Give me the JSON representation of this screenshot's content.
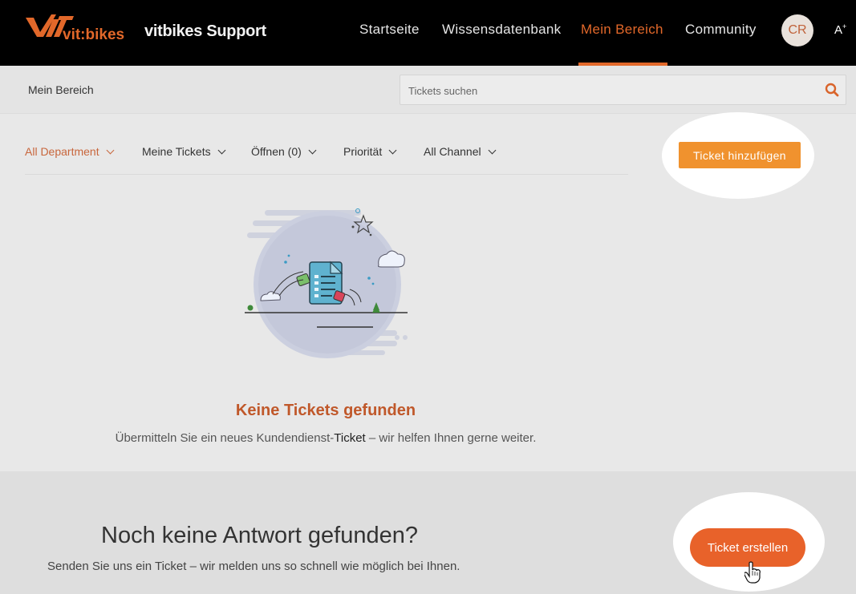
{
  "header": {
    "logo_text": "vit:bikes",
    "brand": "vitbikes Support",
    "nav": [
      {
        "label": "Startseite",
        "active": false
      },
      {
        "label": "Wissensdatenbank",
        "active": false
      },
      {
        "label": "Mein Bereich",
        "active": true
      },
      {
        "label": "Community",
        "active": false
      }
    ],
    "avatar_initials": "CR",
    "font_size_toggle": "A",
    "accent_color": "#e2682a"
  },
  "subbar": {
    "breadcrumb": "Mein Bereich",
    "search_placeholder": "Tickets suchen"
  },
  "filters": [
    {
      "label": "All Department",
      "active": true
    },
    {
      "label": "Meine Tickets",
      "active": false
    },
    {
      "label": "Öffnen (0)",
      "active": false
    },
    {
      "label": "Priorität",
      "active": false
    },
    {
      "label": "All Channel",
      "active": false
    }
  ],
  "add_ticket_label": "Ticket hinzufügen",
  "empty_state": {
    "title": "Keine Tickets gefunden",
    "sub_before": "Übermitteln Sie ein neues Kundendienst-",
    "sub_strong": "Ticket",
    "sub_after": " – wir helfen Ihnen gerne weiter."
  },
  "cta": {
    "title": "Noch keine Antwort gefunden?",
    "subtitle": "Senden Sie uns ein Ticket – wir melden uns so schnell wie möglich bei Ihnen.",
    "button_label": "Ticket erstellen",
    "button_color": "#e8622a"
  }
}
